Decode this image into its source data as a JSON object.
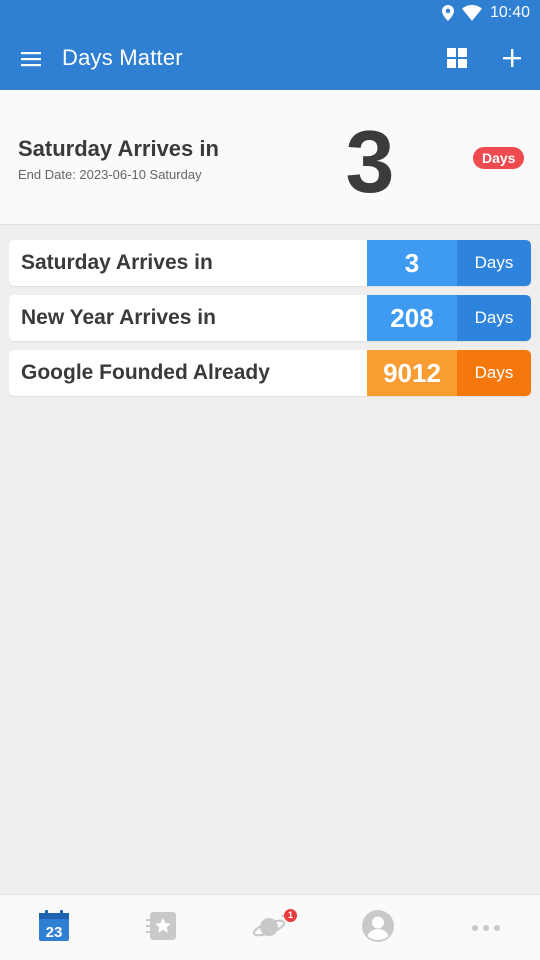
{
  "status_bar": {
    "time": "10:40"
  },
  "app_bar": {
    "title": "Days Matter"
  },
  "featured": {
    "title": "Saturday Arrives in",
    "subtitle": "End Date: 2023-06-10 Saturday",
    "count": "3",
    "badge": "Days"
  },
  "events": [
    {
      "label": "Saturday Arrives in",
      "count": "3",
      "unit": "Days",
      "accent": "#3f9af2",
      "accent_dark": "#2e83dc"
    },
    {
      "label": "New Year Arrives in",
      "count": "208",
      "unit": "Days",
      "accent": "#3f9af2",
      "accent_dark": "#2e83dc"
    },
    {
      "label": "Google Founded Already",
      "count": "9012",
      "unit": "Days",
      "accent": "#f99c31",
      "accent_dark": "#f5780c"
    }
  ],
  "bottom_nav": {
    "calendar_day": "23",
    "notification_count": "1",
    "items": [
      "calendar-icon",
      "star-card-icon",
      "planet-icon",
      "profile-icon",
      "more-icon"
    ]
  },
  "colors": {
    "primary": "#2f7fd3",
    "badge_red": "#ef4a4f"
  }
}
